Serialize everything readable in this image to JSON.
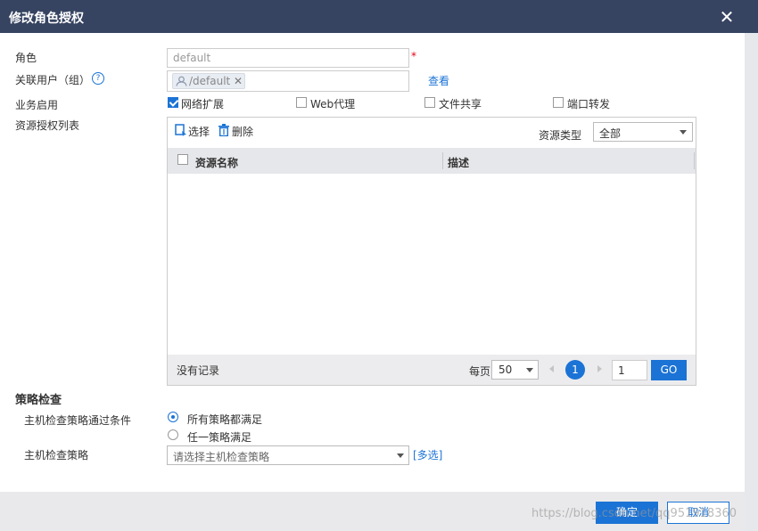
{
  "dialog": {
    "title": "修改角色授权",
    "close_glyph": "✕"
  },
  "form": {
    "role_label": "角色",
    "role_value": "default",
    "required_mark": "*",
    "user_label": "关联用户（组）",
    "help_glyph": "?",
    "user_chip": "/default",
    "chip_remove": "✕",
    "view_link": "查看",
    "service_label": "业务启用",
    "services": [
      {
        "label": "网络扩展",
        "checked": true
      },
      {
        "label": "Web代理",
        "checked": false
      },
      {
        "label": "文件共享",
        "checked": false
      },
      {
        "label": "端口转发",
        "checked": false
      }
    ],
    "resource_list_label": "资源授权列表"
  },
  "resource_panel": {
    "select_label": "选择",
    "delete_label": "删除",
    "type_label": "资源类型",
    "type_value": "全部",
    "columns": [
      "资源名称",
      "描述"
    ],
    "rows": [],
    "empty_text": "没有记录",
    "per_page_label": "每页",
    "per_page_value": "50",
    "current_page": "1",
    "page_input_value": "1",
    "go_label": "GO"
  },
  "policy": {
    "section_title": "策略检查",
    "condition_label": "主机检查策略通过条件",
    "options": [
      {
        "label": "所有策略都满足",
        "selected": true
      },
      {
        "label": "任一策略满足",
        "selected": false
      }
    ],
    "policy_label": "主机检查策略",
    "policy_placeholder": "请选择主机检查策略",
    "multi_select_link": "[多选]"
  },
  "footer": {
    "ok_label": "确定",
    "cancel_label": "取消"
  },
  "watermark": "https://blog.csdn.net/qq951918360"
}
